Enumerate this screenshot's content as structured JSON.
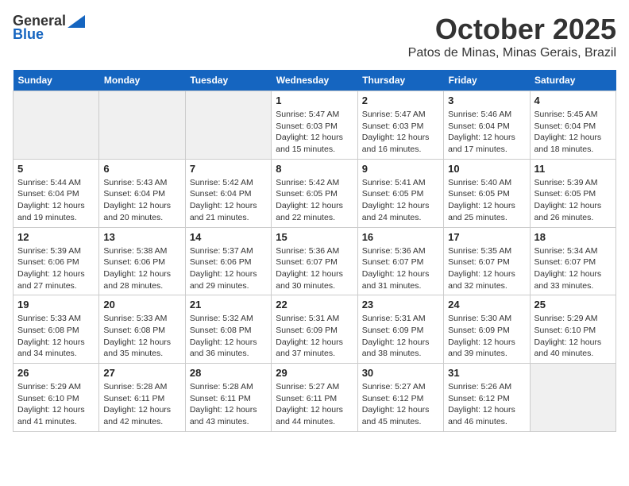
{
  "header": {
    "logo_general": "General",
    "logo_blue": "Blue",
    "title": "October 2025",
    "subtitle": "Patos de Minas, Minas Gerais, Brazil"
  },
  "days_of_week": [
    "Sunday",
    "Monday",
    "Tuesday",
    "Wednesday",
    "Thursday",
    "Friday",
    "Saturday"
  ],
  "weeks": [
    [
      {
        "day": "",
        "content": "",
        "shaded": true
      },
      {
        "day": "",
        "content": "",
        "shaded": true
      },
      {
        "day": "",
        "content": "",
        "shaded": true
      },
      {
        "day": "1",
        "content": "Sunrise: 5:47 AM\nSunset: 6:03 PM\nDaylight: 12 hours\nand 15 minutes.",
        "shaded": false
      },
      {
        "day": "2",
        "content": "Sunrise: 5:47 AM\nSunset: 6:03 PM\nDaylight: 12 hours\nand 16 minutes.",
        "shaded": false
      },
      {
        "day": "3",
        "content": "Sunrise: 5:46 AM\nSunset: 6:04 PM\nDaylight: 12 hours\nand 17 minutes.",
        "shaded": false
      },
      {
        "day": "4",
        "content": "Sunrise: 5:45 AM\nSunset: 6:04 PM\nDaylight: 12 hours\nand 18 minutes.",
        "shaded": false
      }
    ],
    [
      {
        "day": "5",
        "content": "Sunrise: 5:44 AM\nSunset: 6:04 PM\nDaylight: 12 hours\nand 19 minutes.",
        "shaded": false
      },
      {
        "day": "6",
        "content": "Sunrise: 5:43 AM\nSunset: 6:04 PM\nDaylight: 12 hours\nand 20 minutes.",
        "shaded": false
      },
      {
        "day": "7",
        "content": "Sunrise: 5:42 AM\nSunset: 6:04 PM\nDaylight: 12 hours\nand 21 minutes.",
        "shaded": false
      },
      {
        "day": "8",
        "content": "Sunrise: 5:42 AM\nSunset: 6:05 PM\nDaylight: 12 hours\nand 22 minutes.",
        "shaded": false
      },
      {
        "day": "9",
        "content": "Sunrise: 5:41 AM\nSunset: 6:05 PM\nDaylight: 12 hours\nand 24 minutes.",
        "shaded": false
      },
      {
        "day": "10",
        "content": "Sunrise: 5:40 AM\nSunset: 6:05 PM\nDaylight: 12 hours\nand 25 minutes.",
        "shaded": false
      },
      {
        "day": "11",
        "content": "Sunrise: 5:39 AM\nSunset: 6:05 PM\nDaylight: 12 hours\nand 26 minutes.",
        "shaded": false
      }
    ],
    [
      {
        "day": "12",
        "content": "Sunrise: 5:39 AM\nSunset: 6:06 PM\nDaylight: 12 hours\nand 27 minutes.",
        "shaded": false
      },
      {
        "day": "13",
        "content": "Sunrise: 5:38 AM\nSunset: 6:06 PM\nDaylight: 12 hours\nand 28 minutes.",
        "shaded": false
      },
      {
        "day": "14",
        "content": "Sunrise: 5:37 AM\nSunset: 6:06 PM\nDaylight: 12 hours\nand 29 minutes.",
        "shaded": false
      },
      {
        "day": "15",
        "content": "Sunrise: 5:36 AM\nSunset: 6:07 PM\nDaylight: 12 hours\nand 30 minutes.",
        "shaded": false
      },
      {
        "day": "16",
        "content": "Sunrise: 5:36 AM\nSunset: 6:07 PM\nDaylight: 12 hours\nand 31 minutes.",
        "shaded": false
      },
      {
        "day": "17",
        "content": "Sunrise: 5:35 AM\nSunset: 6:07 PM\nDaylight: 12 hours\nand 32 minutes.",
        "shaded": false
      },
      {
        "day": "18",
        "content": "Sunrise: 5:34 AM\nSunset: 6:07 PM\nDaylight: 12 hours\nand 33 minutes.",
        "shaded": false
      }
    ],
    [
      {
        "day": "19",
        "content": "Sunrise: 5:33 AM\nSunset: 6:08 PM\nDaylight: 12 hours\nand 34 minutes.",
        "shaded": false
      },
      {
        "day": "20",
        "content": "Sunrise: 5:33 AM\nSunset: 6:08 PM\nDaylight: 12 hours\nand 35 minutes.",
        "shaded": false
      },
      {
        "day": "21",
        "content": "Sunrise: 5:32 AM\nSunset: 6:08 PM\nDaylight: 12 hours\nand 36 minutes.",
        "shaded": false
      },
      {
        "day": "22",
        "content": "Sunrise: 5:31 AM\nSunset: 6:09 PM\nDaylight: 12 hours\nand 37 minutes.",
        "shaded": false
      },
      {
        "day": "23",
        "content": "Sunrise: 5:31 AM\nSunset: 6:09 PM\nDaylight: 12 hours\nand 38 minutes.",
        "shaded": false
      },
      {
        "day": "24",
        "content": "Sunrise: 5:30 AM\nSunset: 6:09 PM\nDaylight: 12 hours\nand 39 minutes.",
        "shaded": false
      },
      {
        "day": "25",
        "content": "Sunrise: 5:29 AM\nSunset: 6:10 PM\nDaylight: 12 hours\nand 40 minutes.",
        "shaded": false
      }
    ],
    [
      {
        "day": "26",
        "content": "Sunrise: 5:29 AM\nSunset: 6:10 PM\nDaylight: 12 hours\nand 41 minutes.",
        "shaded": false
      },
      {
        "day": "27",
        "content": "Sunrise: 5:28 AM\nSunset: 6:11 PM\nDaylight: 12 hours\nand 42 minutes.",
        "shaded": false
      },
      {
        "day": "28",
        "content": "Sunrise: 5:28 AM\nSunset: 6:11 PM\nDaylight: 12 hours\nand 43 minutes.",
        "shaded": false
      },
      {
        "day": "29",
        "content": "Sunrise: 5:27 AM\nSunset: 6:11 PM\nDaylight: 12 hours\nand 44 minutes.",
        "shaded": false
      },
      {
        "day": "30",
        "content": "Sunrise: 5:27 AM\nSunset: 6:12 PM\nDaylight: 12 hours\nand 45 minutes.",
        "shaded": false
      },
      {
        "day": "31",
        "content": "Sunrise: 5:26 AM\nSunset: 6:12 PM\nDaylight: 12 hours\nand 46 minutes.",
        "shaded": false
      },
      {
        "day": "",
        "content": "",
        "shaded": true
      }
    ]
  ]
}
